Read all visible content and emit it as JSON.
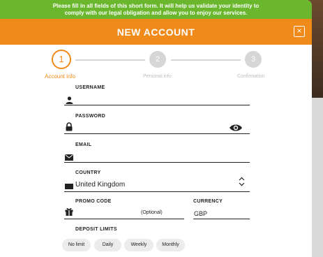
{
  "notice": {
    "line1": "Please fill in all fields of this short form. It will help us validate your identity to",
    "line2": "comply with our legal obligation and allow you to enjoy our services."
  },
  "header": {
    "title": "NEW ACCOUNT",
    "close_glyph": "×"
  },
  "stepper": {
    "steps": [
      {
        "number": "1",
        "label": "Account info",
        "state": "active"
      },
      {
        "number": "2",
        "label": "Personal info",
        "state": "inactive"
      },
      {
        "number": "3",
        "label": "Confirmation",
        "state": "inactive"
      }
    ]
  },
  "form": {
    "username": {
      "label": "USERNAME",
      "value": "",
      "icon": "person-icon"
    },
    "password": {
      "label": "PASSWORD",
      "value": "",
      "icon": "lock-icon",
      "toggle_icon": "eye-icon"
    },
    "email": {
      "label": "EMAIL",
      "value": "",
      "icon": "envelope-icon"
    },
    "country": {
      "label": "COUNTRY",
      "value": "United Kingdom",
      "icon": "flag-icon"
    },
    "promo": {
      "label": "PROMO CODE",
      "value": "",
      "optional": "(Optional)",
      "icon": "gift-icon"
    },
    "currency": {
      "label": "CURRENCY",
      "value": "GBP"
    },
    "deposit_limits": {
      "label": "DEPOSIT LIMITS",
      "options": [
        "No limit",
        "Daily",
        "Weekly",
        "Monthly"
      ]
    }
  },
  "colors": {
    "accent": "#f08a18",
    "notice": "#6ab72e",
    "inactive": "#d6d6d6"
  }
}
